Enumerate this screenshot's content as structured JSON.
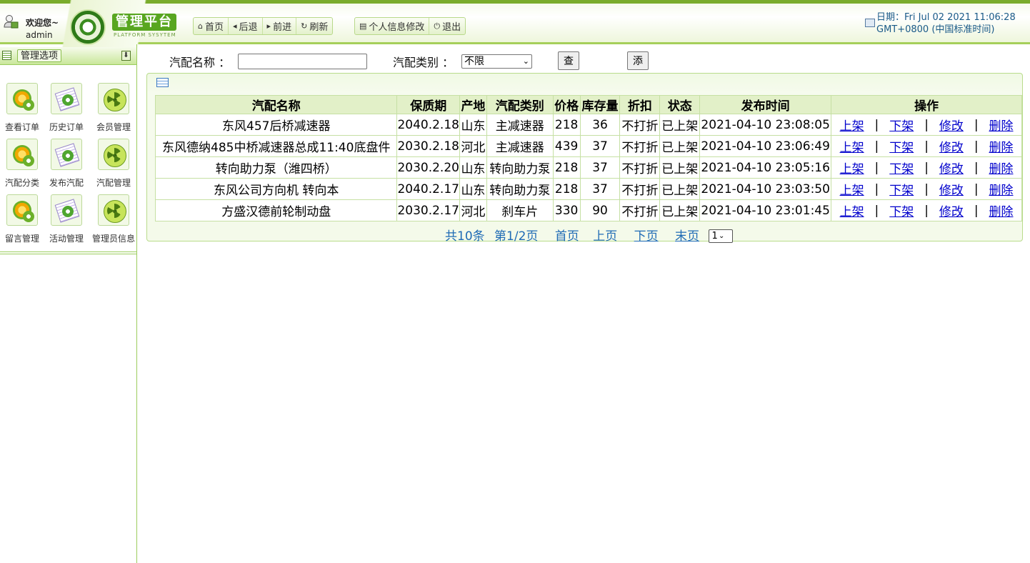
{
  "header": {
    "welcome": "欢迎您~",
    "username": "admin",
    "logo_title": "管理平台",
    "logo_sub": "PLATFORM SYSYTEM",
    "nav": [
      {
        "icon": "home-icon",
        "glyph": "⌂",
        "label": "首页"
      },
      {
        "icon": "back-icon",
        "glyph": "◂",
        "label": "后退"
      },
      {
        "icon": "forward-icon",
        "glyph": "▸",
        "label": "前进"
      },
      {
        "icon": "refresh-icon",
        "glyph": "↻",
        "label": "刷新"
      }
    ],
    "user_nav": [
      {
        "icon": "profile-icon",
        "glyph": "▤",
        "label": "个人信息修改"
      },
      {
        "icon": "logout-icon",
        "glyph": "⏻",
        "label": "退出"
      }
    ],
    "date_line1": "日期：Fri Jul 02 2021 11:06:28",
    "date_line2": "GMT+0800 (中国标准时间)"
  },
  "sidebar": {
    "title": "管理选项",
    "items": [
      {
        "label": "查看订单",
        "icon": "gear-icon"
      },
      {
        "label": "历史订单",
        "icon": "document-icon"
      },
      {
        "label": "会员管理",
        "icon": "radiation-icon"
      },
      {
        "label": "汽配分类",
        "icon": "gear-icon"
      },
      {
        "label": "发布汽配",
        "icon": "document-icon"
      },
      {
        "label": "汽配管理",
        "icon": "radiation-icon"
      },
      {
        "label": "留言管理",
        "icon": "gear-icon"
      },
      {
        "label": "活动管理",
        "icon": "document-icon"
      },
      {
        "label": "管理员信息",
        "icon": "radiation-icon"
      }
    ]
  },
  "search": {
    "name_label": "汽配名称 ：",
    "name_value": "",
    "type_label": "汽配类别 ：",
    "type_selected": "不限",
    "query_button": "查询信息",
    "add_button": "添加信息"
  },
  "table": {
    "headers": [
      "汽配名称",
      "保质期",
      "产地",
      "汽配类别",
      "价格",
      "库存量",
      "折扣",
      "状态",
      "发布时间",
      "操作"
    ],
    "rows": [
      [
        "东风457后桥减速器",
        "2040.2.18",
        "山东",
        "主减速器",
        "218",
        "36",
        "不打折",
        "已上架",
        "2021-04-10 23:08:05"
      ],
      [
        "东风德纳485中桥减速器总成11:40底盘件",
        "2030.2.18",
        "河北",
        "主减速器",
        "439",
        "37",
        "不打折",
        "已上架",
        "2021-04-10 23:06:49"
      ],
      [
        "转向助力泵（潍四桥）",
        "2030.2.20",
        "山东",
        "转向助力泵",
        "218",
        "37",
        "不打折",
        "已上架",
        "2021-04-10 23:05:16"
      ],
      [
        "东风公司方向机 转向本",
        "2040.2.17",
        "山东",
        "转向助力泵",
        "218",
        "37",
        "不打折",
        "已上架",
        "2021-04-10 23:03:50"
      ],
      [
        "方盛汉德前轮制动盘",
        "2030.2.17",
        "河北",
        "刹车片",
        "330",
        "90",
        "不打折",
        "已上架",
        "2021-04-10 23:01:45"
      ]
    ],
    "actions": [
      "上架",
      "下架",
      "修改",
      "删除"
    ],
    "separator": "|"
  },
  "pager": {
    "total": "共10条",
    "page": "第1/2页",
    "first": "首页",
    "prev": "上页",
    "next": "下页",
    "last": "末页",
    "selected": "1"
  }
}
